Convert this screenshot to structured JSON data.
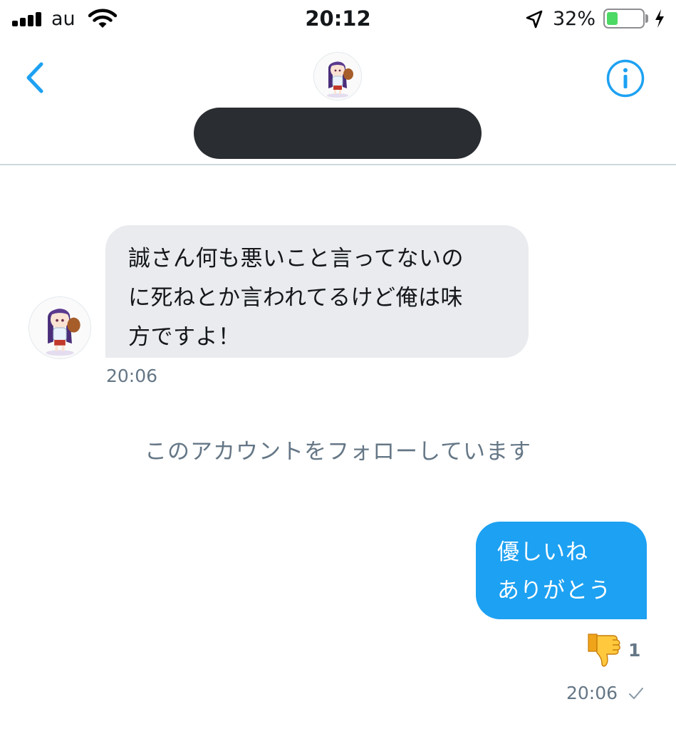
{
  "status_bar": {
    "carrier": "au",
    "time": "20:12",
    "battery_percent_label": "32%",
    "battery_level": 0.32,
    "charging": true,
    "location_active": true,
    "icons": [
      "signal-bars-icon",
      "wifi-icon",
      "location-arrow-icon",
      "battery-icon",
      "charging-bolt-icon"
    ]
  },
  "header": {
    "back_icon": "chevron-left-icon",
    "info_icon": "info-circle-icon",
    "avatar": "anime-character-avatar",
    "name_redacted": true
  },
  "messages": [
    {
      "direction": "incoming",
      "text": "誠さん何も悪いこと言ってないの\nに死ねとか言われてるけど俺は味\n方ですよ！",
      "time": "20:06"
    },
    {
      "direction": "outgoing",
      "text": "優しいね\nありがとう",
      "reaction_emoji": "👎",
      "reaction_count": "1",
      "time": "20:06",
      "status_icon": "checkmark-icon"
    }
  ],
  "follow_note": "このアカウントをフォローしています",
  "colors": {
    "accent": "#1da1f2",
    "incoming_bubble": "#e9ebee",
    "muted_text": "#657786",
    "divider": "#cfd9de",
    "battery_fill": "#4cd964"
  }
}
